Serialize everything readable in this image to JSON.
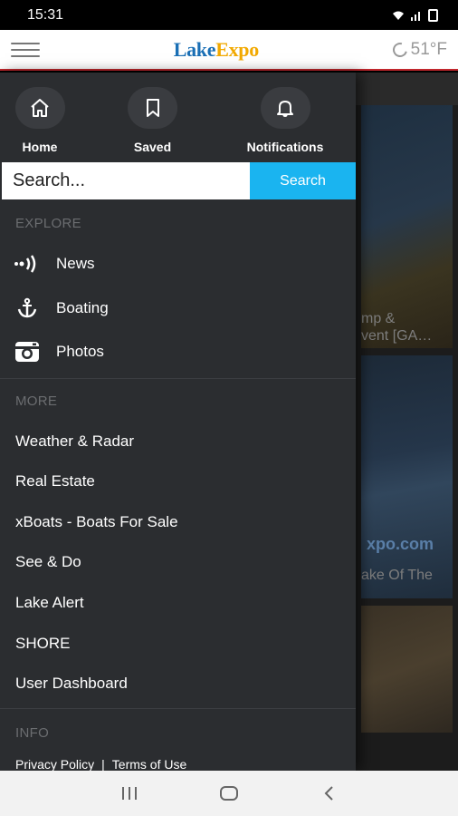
{
  "status_bar": {
    "time": "15:31"
  },
  "header": {
    "logo_part1": "Lake",
    "logo_part2": "Expo",
    "temperature": "51°F"
  },
  "quick_links": [
    {
      "label": "Home",
      "icon": "home-icon"
    },
    {
      "label": "Saved",
      "icon": "bookmark-icon"
    },
    {
      "label": "Notifications",
      "icon": "bell-icon"
    }
  ],
  "search": {
    "placeholder": "Search...",
    "button_label": "Search"
  },
  "explore": {
    "title": "EXPLORE",
    "items": [
      {
        "label": "News",
        "icon": "broadcast-icon"
      },
      {
        "label": "Boating",
        "icon": "anchor-icon"
      },
      {
        "label": "Photos",
        "icon": "camera-icon"
      }
    ]
  },
  "more": {
    "title": "MORE",
    "items": [
      {
        "label": "Weather & Radar"
      },
      {
        "label": "Real Estate"
      },
      {
        "label": "xBoats - Boats For Sale"
      },
      {
        "label": "See & Do"
      },
      {
        "label": "Lake Alert"
      },
      {
        "label": "SHORE"
      },
      {
        "label": "User Dashboard"
      }
    ]
  },
  "info": {
    "title": "INFO",
    "privacy_label": "Privacy Policy",
    "separator": "|",
    "terms_label": "Terms of Use"
  },
  "background_cards": [
    {
      "caption_line1": "mp &",
      "caption_line2": "vent [GA…"
    },
    {
      "overlay_logo": "xpo.com",
      "caption_line1": "ake Of The"
    }
  ],
  "colors": {
    "drawer_bg": "#2b2d30",
    "accent_blue": "#1ab4f0",
    "logo_blue": "#1a6fb5",
    "logo_gold": "#f2a900",
    "header_rule": "#c1272d"
  }
}
